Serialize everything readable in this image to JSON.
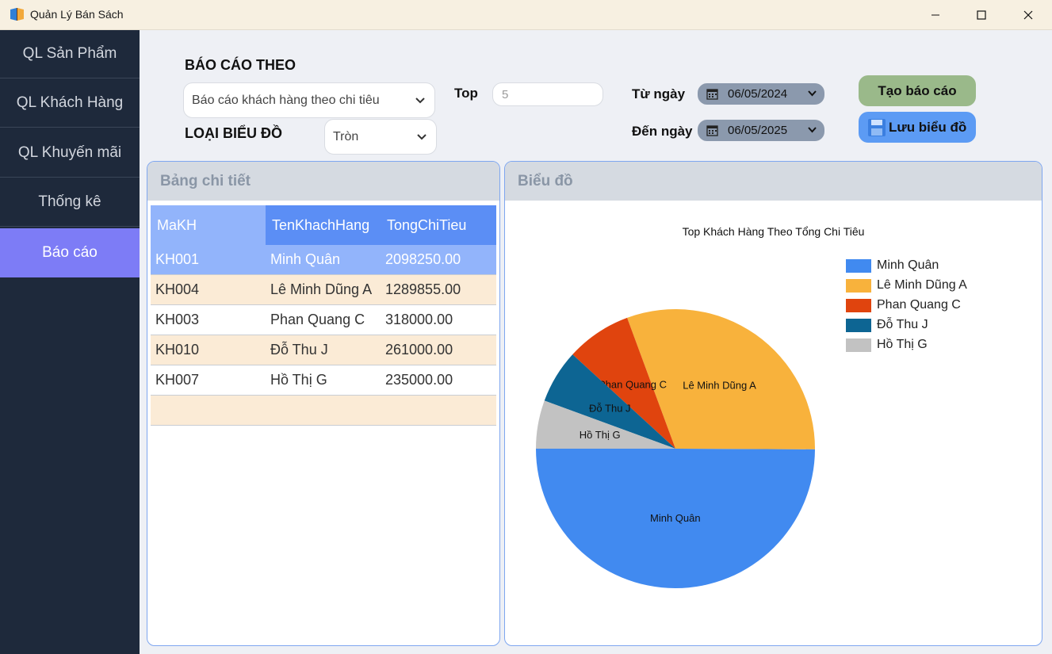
{
  "window": {
    "title": "Quản Lý Bán Sách"
  },
  "sidebar": {
    "items": [
      {
        "label": "QL Sản Phẩm"
      },
      {
        "label": "QL Khách Hàng"
      },
      {
        "label": "QL Khuyến mãi"
      },
      {
        "label": "Thống kê"
      },
      {
        "label": "Báo cáo",
        "active": true
      }
    ]
  },
  "filters": {
    "report_by_label": "BÁO CÁO THEO",
    "report_type_value": "Báo cáo khách hàng theo chi tiêu",
    "chart_type_label": "LOẠI BIỂU ĐỒ",
    "chart_type_value": "Tròn",
    "top_label": "Top",
    "top_value": "5",
    "from_label": "Từ ngày",
    "from_value": "06/05/2024",
    "to_label": "Đến ngày",
    "to_value": "06/05/2025"
  },
  "buttons": {
    "create_label": "Tạo báo cáo",
    "save_label": "Lưu biểu đồ"
  },
  "table_panel": {
    "title": "Bảng chi tiết",
    "columns": [
      "MaKH",
      "TenKhachHang",
      "TongChiTieu"
    ],
    "rows": [
      [
        "KH001",
        "Minh Quân",
        "2098250.00"
      ],
      [
        "KH004",
        "Lê Minh Dũng A",
        "1289855.00"
      ],
      [
        "KH003",
        "Phan Quang C",
        "318000.00"
      ],
      [
        "KH010",
        "Đỗ Thu J",
        "261000.00"
      ],
      [
        "KH007",
        "Hồ Thị G",
        "235000.00"
      ]
    ]
  },
  "chart_panel": {
    "title": "Biểu đồ"
  },
  "colors": {
    "sidebar_bg": "#1e293b",
    "active_nav": "#7d7cf6",
    "header_blue": "#5b8ef5",
    "selected_row": "#92b4fb",
    "alt_row": "#fbebd6"
  },
  "chart_data": {
    "type": "pie",
    "title": "Top Khách Hàng Theo Tổng Chi Tiêu",
    "categories": [
      "Minh Quân",
      "Lê Minh Dũng A",
      "Phan Quang C",
      "Đỗ Thu J",
      "Hồ Thị G"
    ],
    "values": [
      2098250,
      1289855,
      318000,
      261000,
      235000
    ],
    "colors": [
      "#418af0",
      "#f8b23c",
      "#e0440e",
      "#0d6593",
      "#c2c2c2"
    ],
    "legend": "top-right"
  }
}
